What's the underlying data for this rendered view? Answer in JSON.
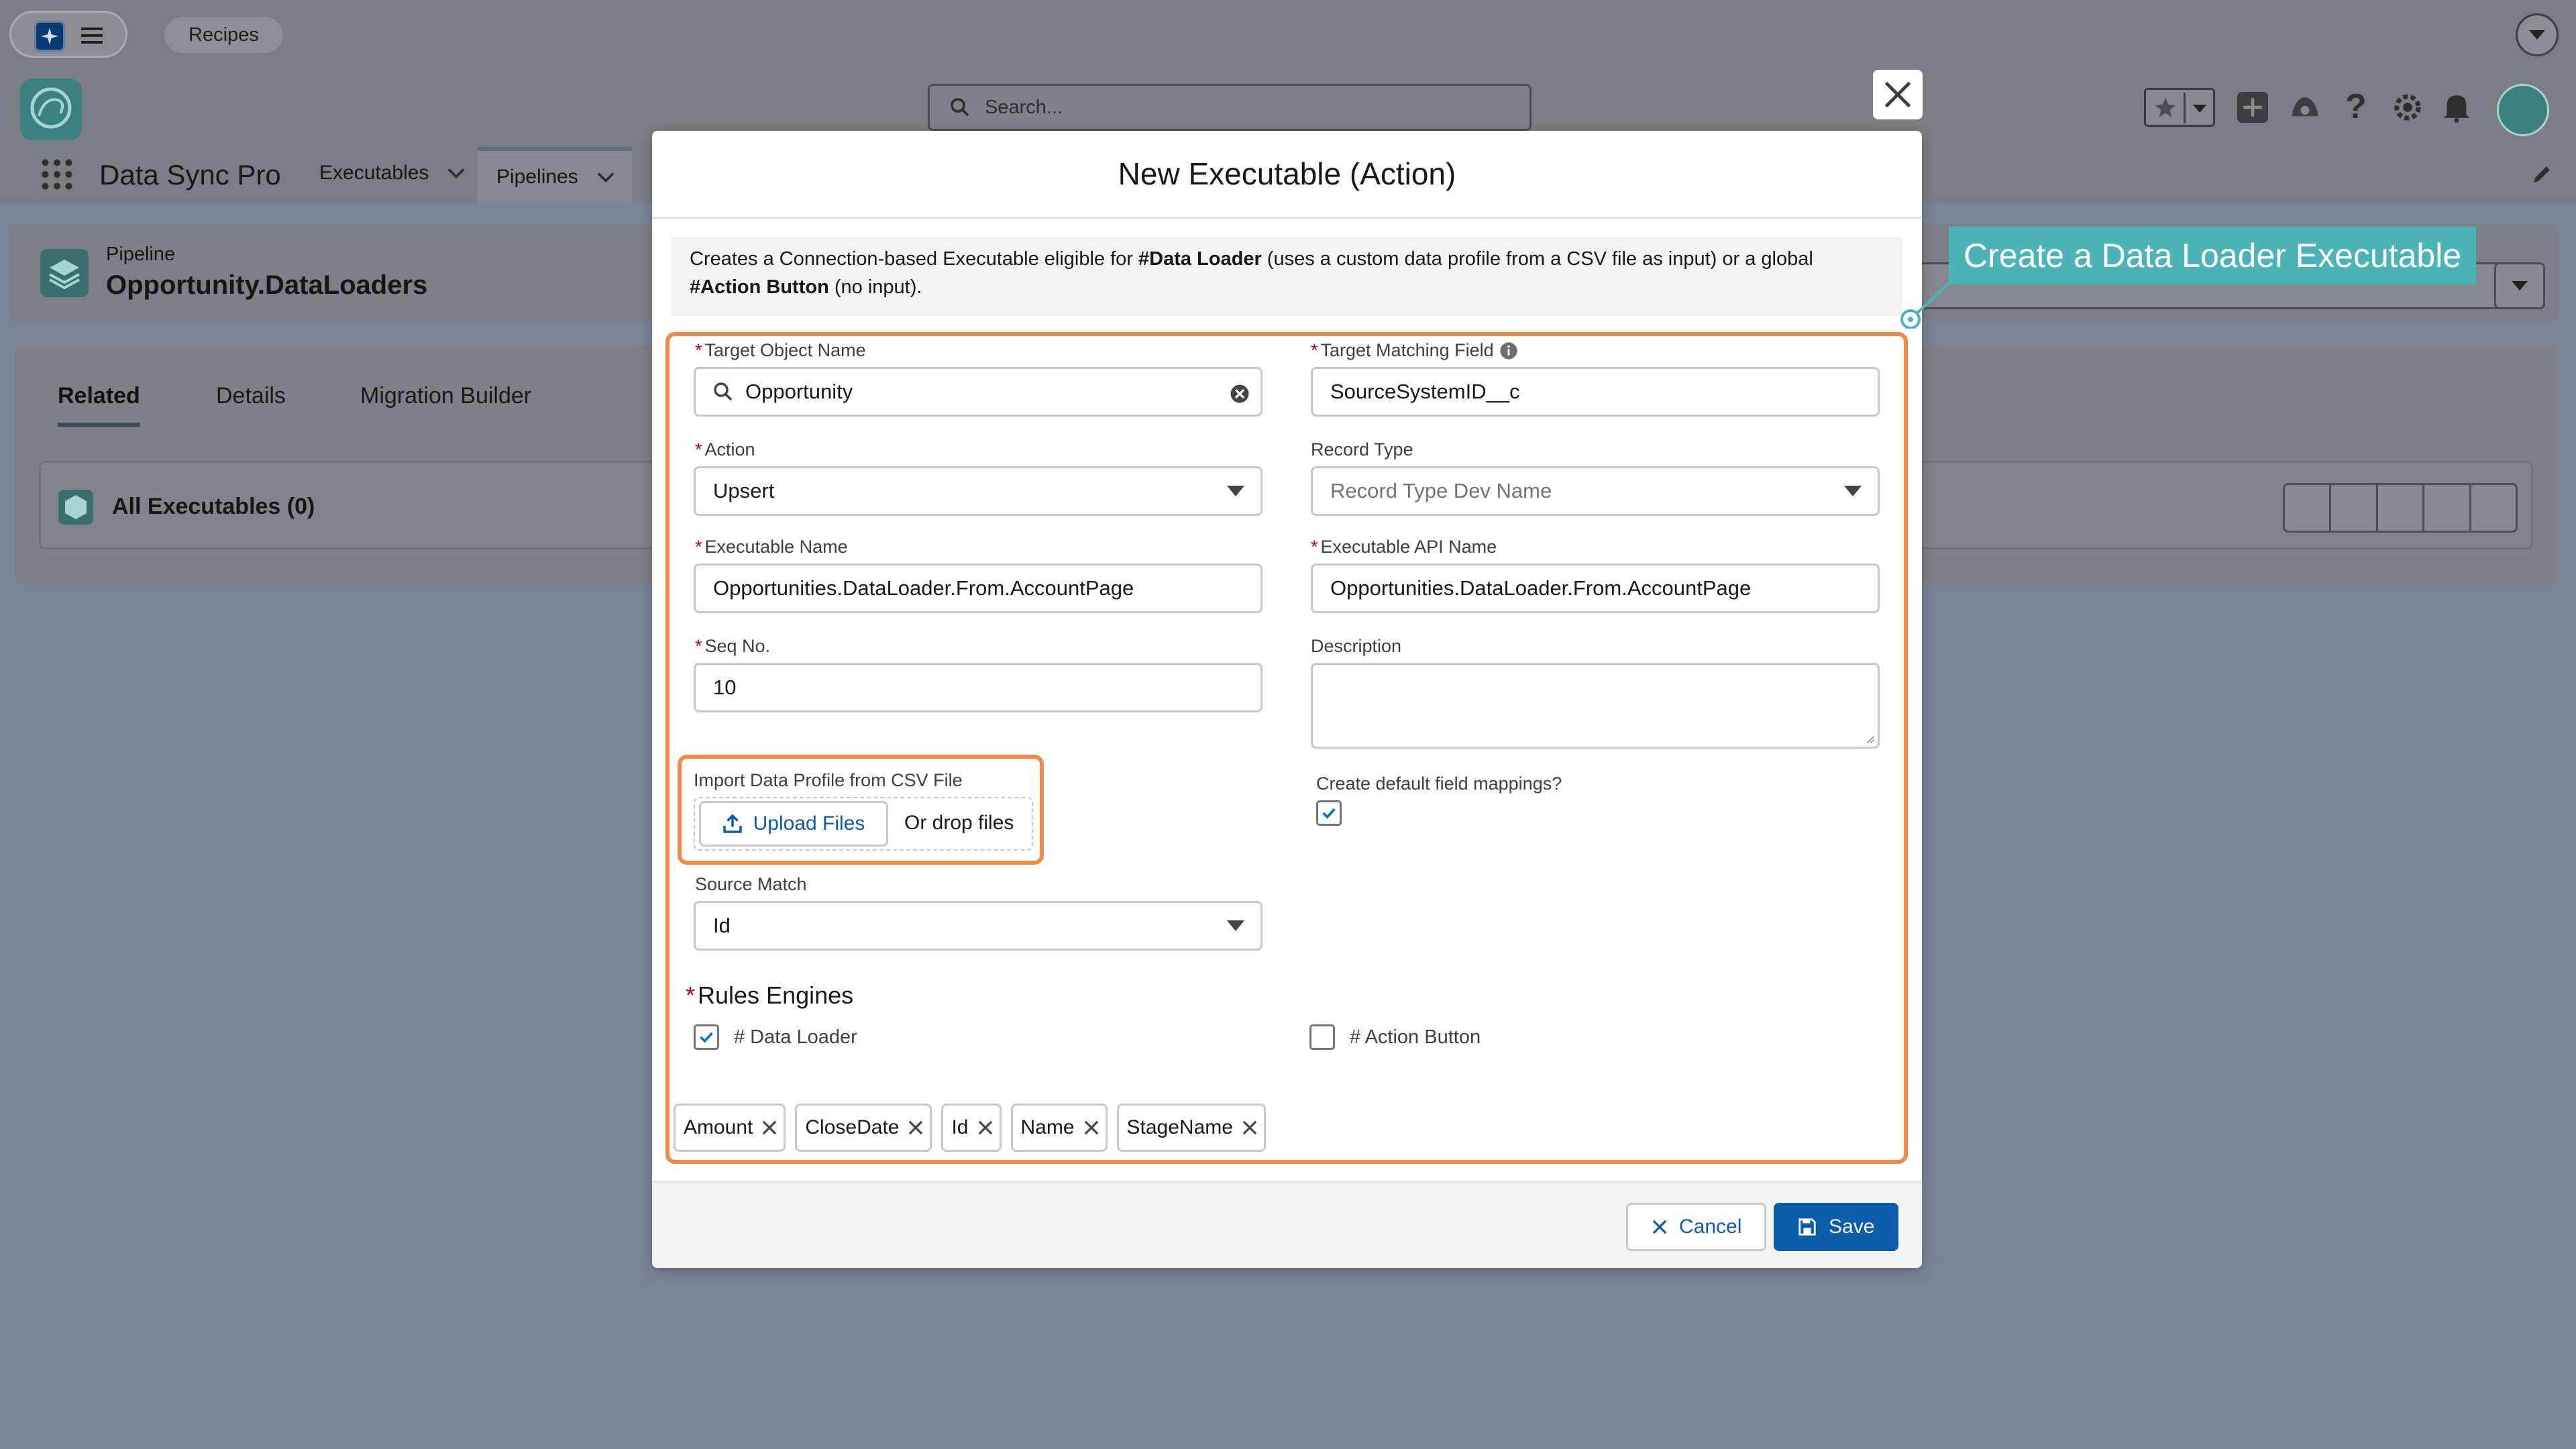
{
  "topbar": {
    "recipes_label": "Recipes"
  },
  "header": {
    "search_placeholder": "Search..."
  },
  "nav": {
    "app_name": "Data Sync Pro",
    "tabs": [
      {
        "label": "Executables"
      },
      {
        "label": "Pipelines"
      }
    ]
  },
  "record": {
    "object_label": "Pipeline",
    "name": "Opportunity.DataLoaders"
  },
  "record_tabs": [
    {
      "label": "Related"
    },
    {
      "label": "Details"
    },
    {
      "label": "Migration Builder"
    }
  ],
  "related": {
    "title": "All Executables (0)"
  },
  "modal": {
    "title": "New Executable (Action)",
    "description": {
      "part1": "Creates a Connection-based Executable eligible for ",
      "bold1": "#Data Loader",
      "part2": " (uses a custom data profile from a CSV file as input) or a global ",
      "bold2": "#Action Button",
      "part3": " (no input)."
    },
    "fields": {
      "target_object": {
        "label": "Target Object Name",
        "value": "Opportunity"
      },
      "target_matching": {
        "label": "Target Matching Field",
        "value": "SourceSystemID__c"
      },
      "action": {
        "label": "Action",
        "value": "Upsert"
      },
      "record_type": {
        "label": "Record Type",
        "placeholder": "Record Type Dev Name"
      },
      "exec_name": {
        "label": "Executable Name",
        "value": "Opportunities.DataLoader.From.AccountPage"
      },
      "exec_api": {
        "label": "Executable API Name",
        "value": "Opportunities.DataLoader.From.AccountPage"
      },
      "seq": {
        "label": "Seq No.",
        "value": "10"
      },
      "description": {
        "label": "Description",
        "value": ""
      },
      "import": {
        "label": "Import Data Profile from CSV File",
        "upload_label": "Upload Files",
        "drop_label": "Or drop files"
      },
      "default_mappings": {
        "label": "Create default field mappings?",
        "checked": true
      },
      "source_match": {
        "label": "Source Match",
        "value": "Id"
      }
    },
    "rules": {
      "title": "Rules Engines",
      "options": [
        {
          "label": "# Data Loader",
          "checked": true
        },
        {
          "label": "# Action Button",
          "checked": false
        }
      ]
    },
    "pills": [
      {
        "label": "Amount"
      },
      {
        "label": "CloseDate"
      },
      {
        "label": "Id"
      },
      {
        "label": "Name"
      },
      {
        "label": "StageName"
      }
    ],
    "footer": {
      "cancel_label": "Cancel",
      "save_label": "Save"
    }
  },
  "callout": {
    "text": "Create a Data Loader Executable"
  },
  "colors": {
    "brand": "#0176d3",
    "save": "#0b5cab",
    "highlight": "#f08a4b",
    "callout": "#4cb3b9"
  }
}
